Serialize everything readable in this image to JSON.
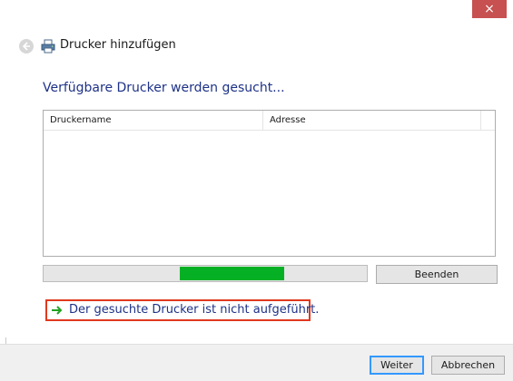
{
  "window": {
    "close_label": "×"
  },
  "header": {
    "title": "Drucker hinzufügen"
  },
  "main": {
    "headline": "Verfügbare Drucker werden gesucht...",
    "columns": [
      "Druckername",
      "Adresse"
    ],
    "progress_indeterminate": true,
    "stop_label": "Beenden",
    "not_listed_link": "Der gesuchte Drucker ist nicht aufgeführt."
  },
  "footer": {
    "next_label": "Weiter",
    "cancel_label": "Abbrechen"
  },
  "colors": {
    "accent_blue": "#1e3287",
    "progress_green": "#06b025",
    "close_red": "#c75050",
    "highlight_box": "#e0391f",
    "link_arrow": "#21a121"
  }
}
